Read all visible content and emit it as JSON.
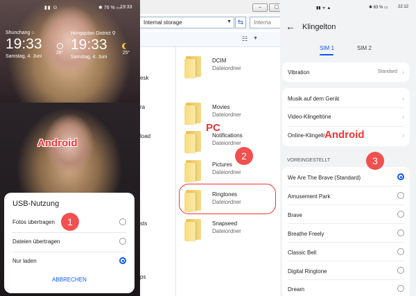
{
  "left": {
    "status": {
      "signal": "▮▮ ⊙",
      "battery": "✱ 76 % ▭",
      "time": "19:33"
    },
    "clocks": [
      {
        "city": "Shunchang ⌂",
        "time": "19:33",
        "date": "Samstag, 4. Juni",
        "temp": "26°"
      },
      {
        "city": "Hongqutan District ⚲",
        "time": "19:33",
        "date": "Samstag, 4. Juni",
        "temp": "25°"
      }
    ],
    "tag": "Android",
    "step": "1",
    "dialog": {
      "title": "USB-Nutzung",
      "options": [
        {
          "label": "Fotos übertragen",
          "selected": false
        },
        {
          "label": "Dateien übertragen",
          "selected": false
        },
        {
          "label": "Nur laden",
          "selected": true
        }
      ],
      "cancel": "ABBRECHEN"
    }
  },
  "mid": {
    "window_buttons": [
      "–",
      "▢",
      "✕"
    ],
    "address": "Internal storage",
    "search_placeholder": "Interna",
    "nav_items": [
      "esk",
      "ra",
      "load",
      "sts",
      "ps"
    ],
    "tag": "PC",
    "step": "2",
    "files": [
      {
        "name": "DCIM",
        "type": "Dateiordner"
      },
      {
        "name": "Movies",
        "type": "Dateiordner"
      },
      {
        "name": "Notifications",
        "type": "Dateiordner"
      },
      {
        "name": "Pictures",
        "type": "Dateiordner"
      },
      {
        "name": "Ringtones",
        "type": "Dateiordner"
      },
      {
        "name": "Snapseed",
        "type": "Dateiordner"
      }
    ],
    "highlighted_file": "Ringtones"
  },
  "right": {
    "status": {
      "signal": "▮▮ ᯤ ▲",
      "battery": "✱ 63 % ▭",
      "time": "22:12"
    },
    "title": "Klingelton",
    "tabs": [
      {
        "label": "SIM 1",
        "active": true
      },
      {
        "label": "SIM 2",
        "active": false
      }
    ],
    "vibration": {
      "label": "Vibration",
      "value": "Standard"
    },
    "menu": [
      "Musik auf dem Gerät",
      "Video-Klingeltöne",
      "Online-Klingeltöne"
    ],
    "tag": "Android",
    "step": "3",
    "section": "VOREINGESTELLT",
    "ringtones": [
      {
        "label": "We Are The Brave (Standard)",
        "selected": true
      },
      {
        "label": "Amusement Park",
        "selected": false
      },
      {
        "label": "Brave",
        "selected": false
      },
      {
        "label": "Breathe Freely",
        "selected": false
      },
      {
        "label": "Classic Bell",
        "selected": false
      },
      {
        "label": "Digital Ringtone",
        "selected": false
      },
      {
        "label": "Dream",
        "selected": false
      }
    ]
  },
  "colors": {
    "accent": "#0a59f7",
    "annotation": "#f0504f",
    "folder": "#f5db86"
  }
}
